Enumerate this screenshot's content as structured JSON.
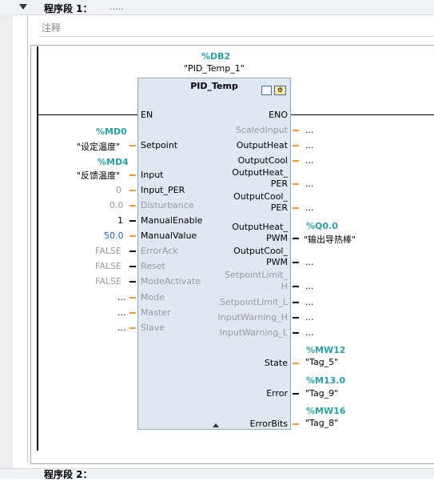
{
  "header": {
    "title": "程序段 1：",
    "placeholder_dots": "....."
  },
  "comment": {
    "label": "注释"
  },
  "instance": {
    "db_address": "%DB2",
    "db_name": "\"PID_Temp_1\""
  },
  "block": {
    "title": "PID_Temp"
  },
  "inputs": {
    "en": "EN",
    "setpoint": {
      "addr": "%MD0",
      "tag": "\"设定温度\"",
      "pin": "Setpoint"
    },
    "input": {
      "addr": "%MD4",
      "tag": "\"反馈温度\"",
      "pin": "Input"
    },
    "input_per": {
      "value": "0",
      "pin": "Input_PER"
    },
    "disturbance": {
      "value": "0.0",
      "pin": "Disturbance"
    },
    "manual_enable": {
      "value": "1",
      "pin": "ManualEnable"
    },
    "manual_value": {
      "value": "50.0",
      "pin": "ManualValue"
    },
    "error_ack": {
      "value": "FALSE",
      "pin": "ErrorAck"
    },
    "reset": {
      "value": "FALSE",
      "pin": "Reset"
    },
    "mode_activate": {
      "value": "FALSE",
      "pin": "ModeActivate"
    },
    "mode": {
      "value": "...",
      "pin": "Mode"
    },
    "master": {
      "value": "...",
      "pin": "Master"
    },
    "slave": {
      "value": "...",
      "pin": "Slave"
    }
  },
  "outputs": {
    "eno": "ENO",
    "scaled_input": {
      "pin": "ScaledInput",
      "value": "..."
    },
    "output_heat": {
      "pin": "OutputHeat",
      "value": "..."
    },
    "output_cool": {
      "pin": "OutputCool",
      "value": "..."
    },
    "output_heat_per": {
      "pin_l1": "OutputHeat_",
      "pin_l2": "PER",
      "value": "..."
    },
    "output_cool_per": {
      "pin_l1": "OutputCool_",
      "pin_l2": "PER",
      "value": "..."
    },
    "output_heat_pwm": {
      "pin_l1": "OutputHeat_",
      "pin_l2": "PWM",
      "addr": "%Q0.0",
      "tag": "\"输出导热棒\""
    },
    "output_cool_pwm": {
      "pin_l1": "OutputCool_",
      "pin_l2": "PWM",
      "value": "..."
    },
    "setpoint_limit_h": {
      "pin_l1": "SetpointLimit_",
      "pin_l2": "H",
      "value": "..."
    },
    "setpoint_limit_l": {
      "pin": "SetpointLimit_L",
      "value": "..."
    },
    "input_warning_h": {
      "pin": "InputWarning_H",
      "value": "..."
    },
    "input_warning_l": {
      "pin": "InputWarning_L",
      "value": "..."
    },
    "state": {
      "pin": "State",
      "addr": "%MW12",
      "tag": "\"Tag_5\""
    },
    "error": {
      "pin": "Error",
      "addr": "%M13.0",
      "tag": "\"Tag_9\""
    },
    "error_bits": {
      "pin": "ErrorBits",
      "addr": "%MW16",
      "tag": "\"Tag_8\""
    }
  },
  "next_network": {
    "title": "程序段 2："
  },
  "colors": {
    "accent_teal": "#2aa0a6",
    "wire_orange": "#f29a2e",
    "block_fill": "#dfe7f1"
  }
}
